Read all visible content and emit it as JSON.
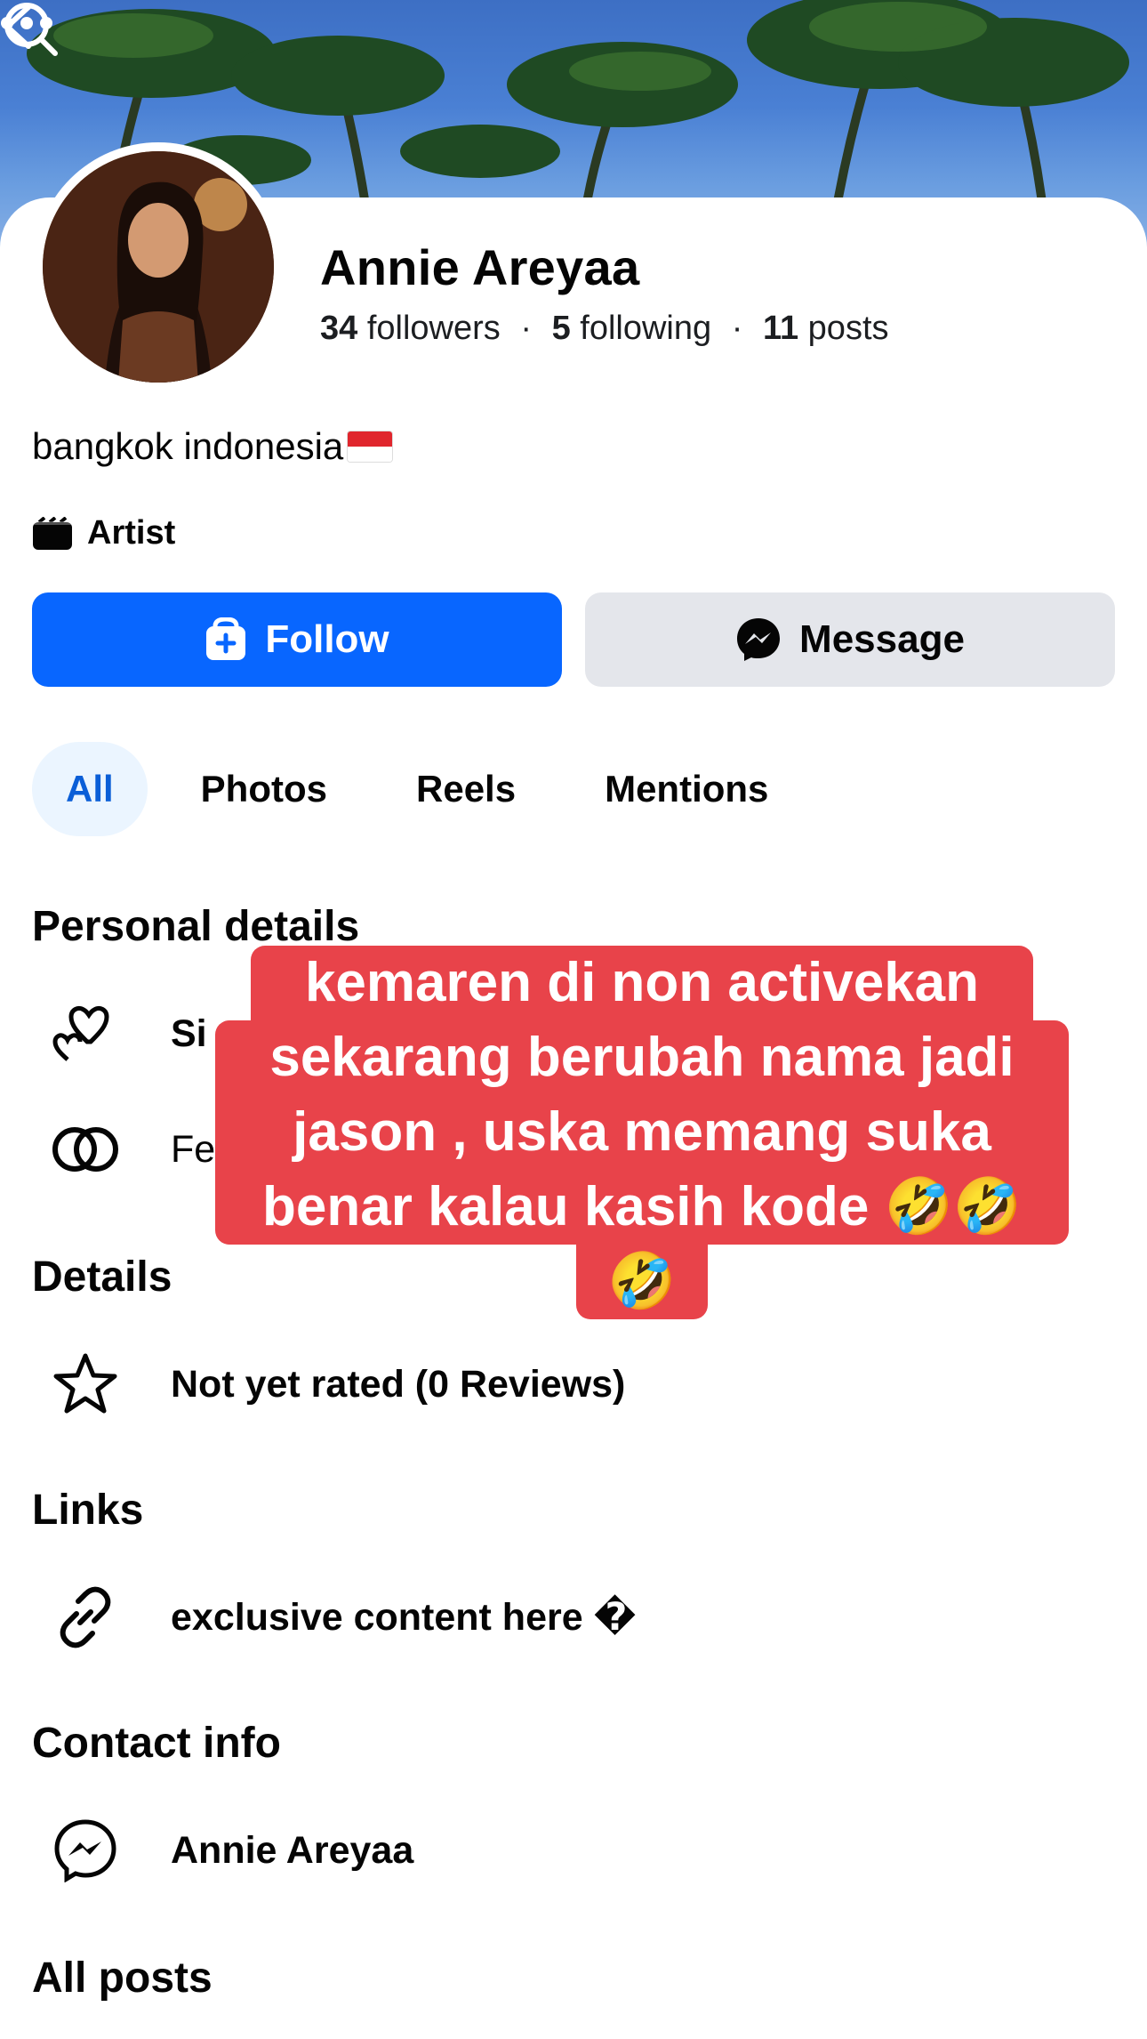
{
  "profile": {
    "name": "Annie Areyaa",
    "followers_count": "34",
    "followers_label": "followers",
    "following_count": "5",
    "following_label": "following",
    "posts_count": "11",
    "posts_label": "posts",
    "separator": "·",
    "bio": "bangkok indonesia",
    "category": "Artist"
  },
  "actions": {
    "follow_label": "Follow",
    "message_label": "Message",
    "primary_color": "#0866ff"
  },
  "tabs": [
    {
      "label": "All",
      "active": true
    },
    {
      "label": "Photos",
      "active": false
    },
    {
      "label": "Reels",
      "active": false
    },
    {
      "label": "Mentions",
      "active": false
    }
  ],
  "sections": {
    "personal_details": {
      "title": "Personal details",
      "items": [
        {
          "icon": "hearts-icon",
          "text": "Si"
        },
        {
          "icon": "rings-icon",
          "text": "Fe"
        }
      ]
    },
    "details": {
      "title": "Details",
      "items": [
        {
          "icon": "star-icon",
          "text": "Not yet rated (0 Reviews)"
        }
      ]
    },
    "links": {
      "title": "Links",
      "items": [
        {
          "icon": "link-icon",
          "text": "exclusive content here �"
        }
      ]
    },
    "contact": {
      "title": "Contact info",
      "items": [
        {
          "icon": "messenger-icon",
          "text": "Annie Areyaa"
        }
      ]
    },
    "all_posts": {
      "title": "All posts"
    }
  },
  "caption": {
    "lines": [
      "kemaren di non activekan",
      "sekarang berubah nama jadi",
      "jason , uska memang suka",
      "benar kalau kasih kode 🤣🤣",
      "🤣"
    ],
    "background": "#e8434a"
  }
}
